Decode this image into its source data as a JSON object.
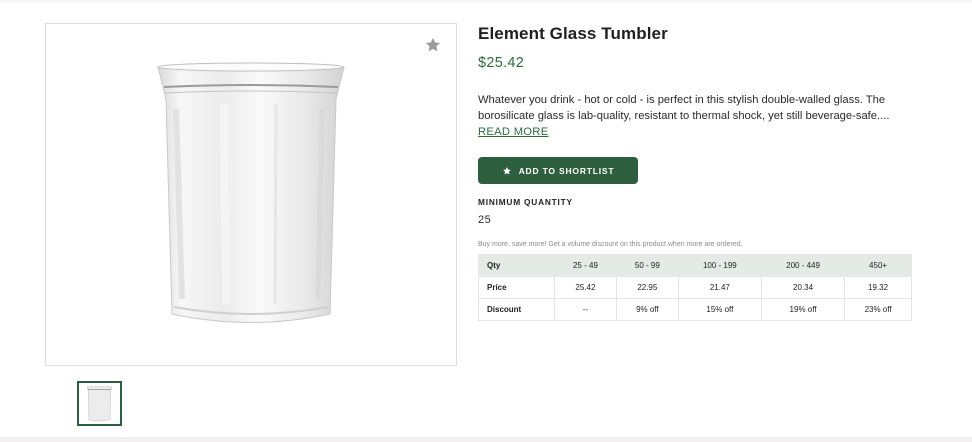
{
  "product": {
    "title": "Element Glass Tumbler",
    "price": "$25.42",
    "description": "Whatever you drink - hot or cold - is perfect in this stylish double-walled glass. The borosilicate glass is lab-quality, resistant to thermal shock, yet still beverage-safe....",
    "read_more_label": "READ MORE"
  },
  "actions": {
    "shortlist_label": "ADD TO SHORTLIST"
  },
  "minimum_quantity": {
    "label": "MINIMUM QUANTITY",
    "value": "25"
  },
  "volume_discount": {
    "note": "Buy more, save more! Get a volume discount on this product when more are ordered.",
    "row_labels": [
      "Qty",
      "Price",
      "Discount"
    ],
    "tiers": [
      {
        "qty": "25 - 49",
        "price": "25.42",
        "discount": "--"
      },
      {
        "qty": "50 - 99",
        "price": "22.95",
        "discount": "9% off"
      },
      {
        "qty": "100 - 199",
        "price": "21.47",
        "discount": "15% off"
      },
      {
        "qty": "200 - 449",
        "price": "20.34",
        "discount": "19% off"
      },
      {
        "qty": "450+",
        "price": "19.32",
        "discount": "23% off"
      }
    ]
  },
  "icons": {
    "favorite": "star-icon",
    "shortlist": "star-icon"
  },
  "colors": {
    "accent": "#2d5e3e",
    "price": "#2d6a3e",
    "table_header": "#e4eae6"
  }
}
